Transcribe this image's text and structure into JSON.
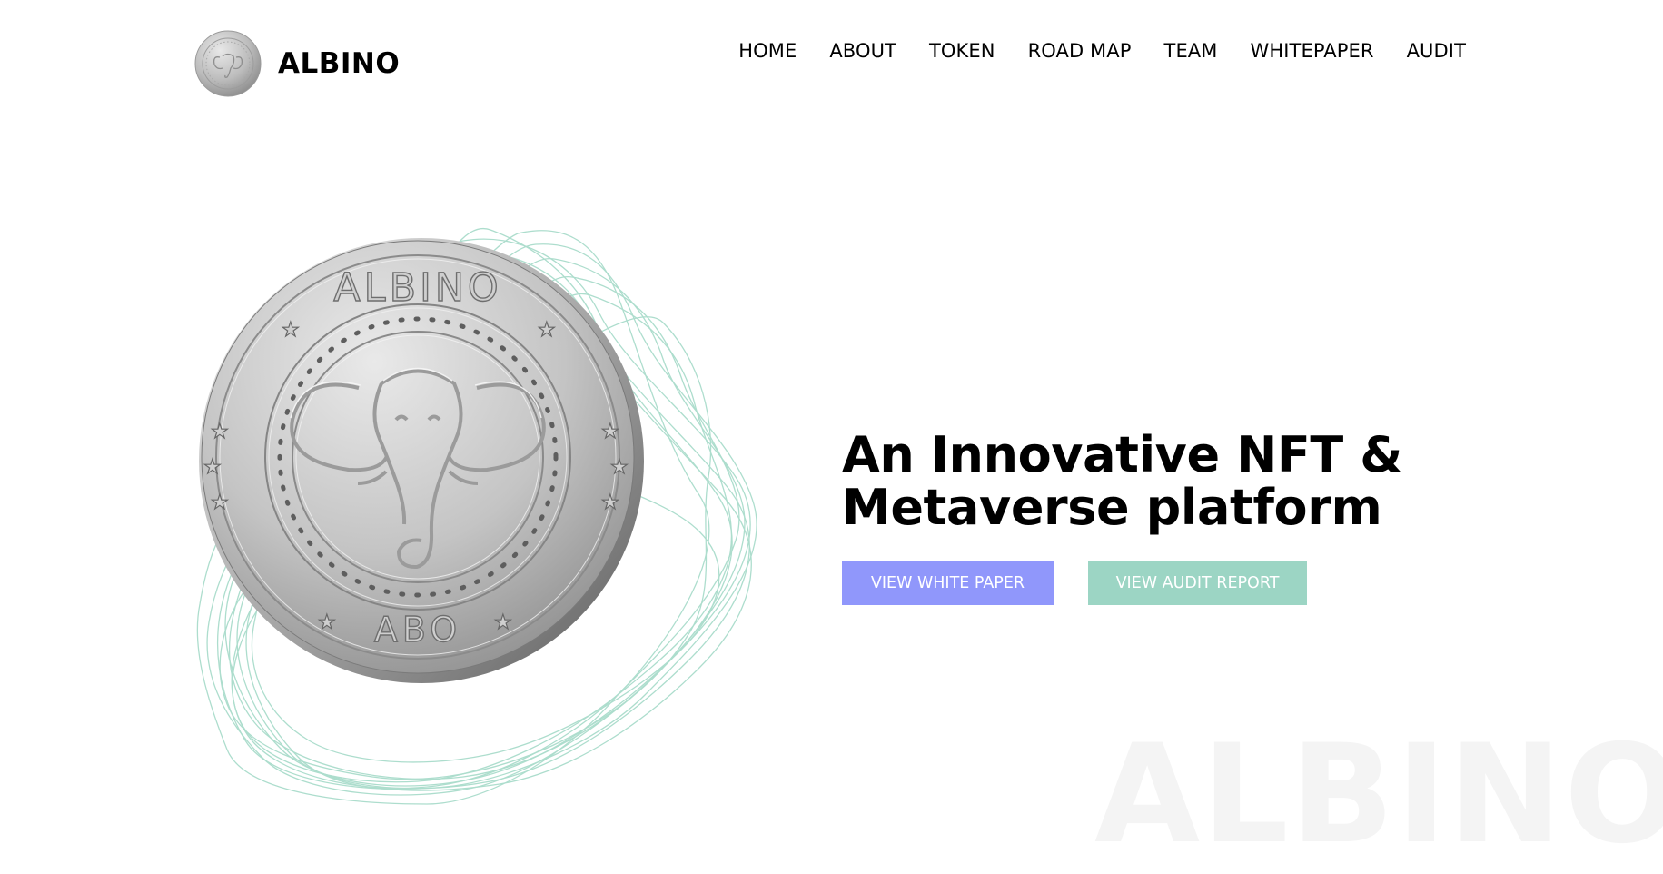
{
  "brand": {
    "name": "ALBINO"
  },
  "nav": {
    "items": [
      {
        "label": "HOME"
      },
      {
        "label": "ABOUT"
      },
      {
        "label": "TOKEN"
      },
      {
        "label": "ROAD MAP"
      },
      {
        "label": "TEAM"
      },
      {
        "label": "WHITEPAPER"
      },
      {
        "label": "AUDIT"
      }
    ]
  },
  "hero": {
    "title_line1": "An Innovative NFT &",
    "title_line2": "Metaverse platform",
    "primary_button": "VIEW WHITE PAPER",
    "secondary_button": "VIEW AUDIT REPORT",
    "watermark": "ALBINO"
  },
  "coin": {
    "top_text": "ALBINO",
    "bottom_text": "ABO"
  },
  "colors": {
    "primary_button": "#9097fb",
    "secondary_button": "#9cd5c4",
    "wave_lines": "#a9dccb",
    "coin_silver": "#c4c4c4"
  },
  "icons": {
    "brand_logo": "elephant-coin-icon"
  }
}
